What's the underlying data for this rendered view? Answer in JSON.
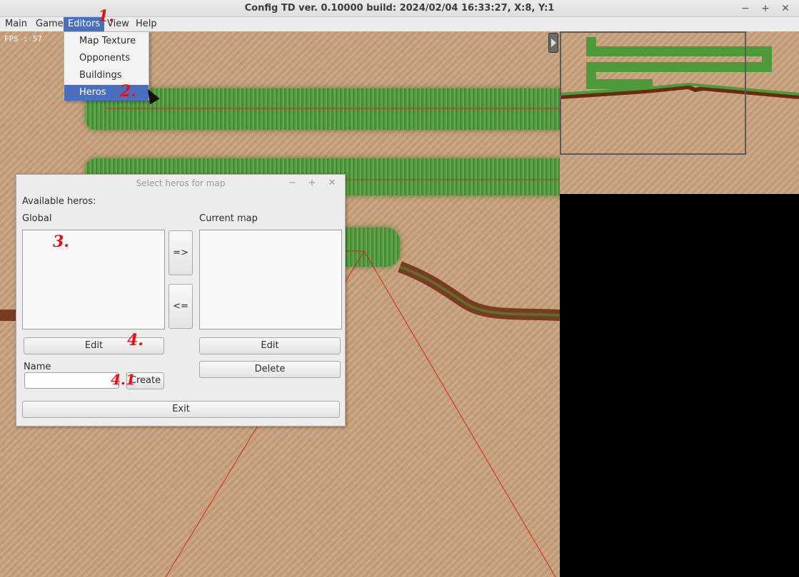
{
  "window": {
    "title": "Config TD ver. 0.10000 build: 2024/02/04  16:33:27, X:8, Y:1",
    "minimize": "−",
    "maximize": "+",
    "close": "✕"
  },
  "menubar": {
    "items": [
      "Main",
      "Game",
      "Editors",
      "View",
      "Help"
    ],
    "active": "Editors"
  },
  "editors_menu": {
    "items": [
      "Map Texture",
      "Opponents",
      "Buildings",
      "Heros"
    ],
    "selected": "Heros"
  },
  "hud": {
    "fps": "FPS : 57"
  },
  "dialog": {
    "title": "Select heros for map",
    "minimize": "−",
    "maximize": "+",
    "close": "✕",
    "available_label": "Available heros:",
    "global_label": "Global",
    "current_map_label": "Current map",
    "move_right": "=>",
    "move_left": "<=",
    "global_edit": "Edit",
    "current_edit": "Edit",
    "delete": "Delete",
    "name_label": "Name",
    "name_value": "",
    "create": "Create",
    "exit": "Exit"
  },
  "annotations": [
    "1.",
    "2.",
    "3.",
    "4.",
    "4.1"
  ],
  "colors": {
    "menu_highlight": "#4a6fc0",
    "annotation": "#e81010",
    "sand": "#c9a37d",
    "grass": "#4f9a3a"
  }
}
